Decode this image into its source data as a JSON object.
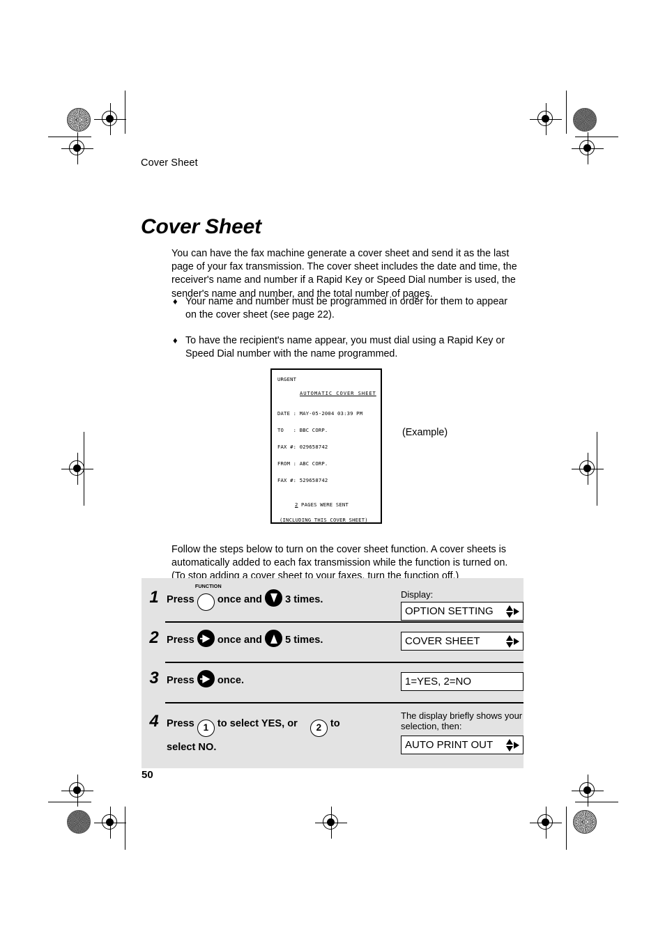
{
  "document": {
    "running_head": "Cover Sheet",
    "title": "Cover Sheet",
    "page_number": "50",
    "intro": "You can have the fax machine generate a cover sheet and send it as the last page of your fax transmission. The cover sheet includes the date and time, the receiver's name and number if a Rapid Key or Speed Dial number is used, the sender's name and number, and the total number of pages.",
    "bullet_glyph": "♦",
    "bullets": [
      "Your name and number must be programmed in order for them to appear on the cover sheet (see page 22).",
      "To have the recipient's name appear, you must dial using a Rapid Key or Speed Dial number with the name programmed."
    ],
    "follow_text": "Follow the steps below to turn on the cover sheet function. A cover sheets is automatically added to each fax transmission while the function is turned on. (To stop adding a cover sheet to your faxes, turn the function off.)",
    "example_label": "(Example)"
  },
  "fax_example": {
    "urgent": "URGENT",
    "heading": "AUTOMATIC COVER SHEET",
    "date": "DATE : MAY-05-2004 03:39 PM",
    "to": "TO   : BBC CORP.",
    "fax_to": "FAX #: 029658742",
    "from": "FROM : ABC CORP.",
    "fax_from": "FAX #: 529658742",
    "pages_count": "2",
    "pages_text": " PAGES WERE SENT",
    "including": "(INCLUDING THIS COVER SHEET)"
  },
  "steps": {
    "display_label": "Display:",
    "items": [
      {
        "number": "1",
        "press_label": "Press",
        "function_caption": "FUNCTION",
        "mid_text": "once and",
        "tail_text": "3 times.",
        "display_label": "Display:",
        "display_value": "OPTION SETTING",
        "display_has_arrows": true
      },
      {
        "number": "2",
        "press_label": "Press",
        "mid_text": "once and",
        "tail_text": "5 times.",
        "display_value": "COVER SHEET",
        "display_has_arrows": true
      },
      {
        "number": "3",
        "press_label": "Press",
        "tail_text": "once.",
        "display_value": "1=YES, 2=NO",
        "display_has_arrows": false
      },
      {
        "number": "4",
        "press_label": "Press",
        "mid_text": "to select YES, or",
        "tail_text": "to",
        "second_line": "select NO.",
        "key_one": "1",
        "key_two": "2",
        "display_note": "The display briefly shows your selection, then:",
        "display_value": "AUTO PRINT OUT",
        "display_has_arrows": true
      }
    ]
  },
  "colors": {
    "panel_background": "#e3e3e3",
    "ink": "#000000",
    "paper": "#ffffff"
  }
}
